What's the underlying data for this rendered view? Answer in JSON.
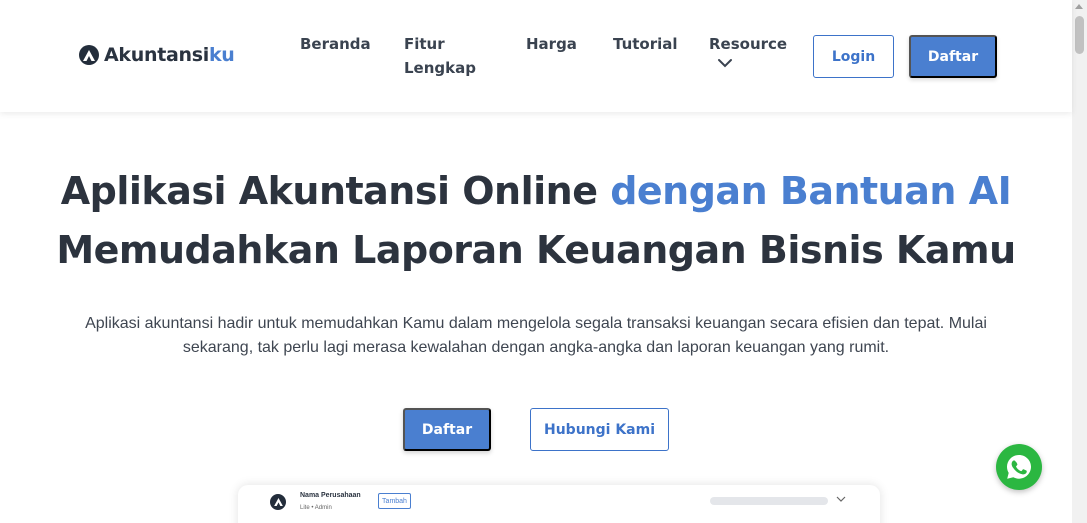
{
  "brand": {
    "name_main": "Akuntansi",
    "name_accent": "ku",
    "accent_color": "#4a7fd0"
  },
  "nav": {
    "beranda": "Beranda",
    "fitur": "Fitur Lengkap",
    "harga": "Harga",
    "tutorial": "Tutorial",
    "resource": "Resource",
    "login": "Login",
    "daftar": "Daftar"
  },
  "hero": {
    "title_part1": "Aplikasi Akuntansi Online ",
    "title_highlight": "dengan Bantuan AI",
    "title_line2": "Memudahkan Laporan Keuangan Bisnis Kamu",
    "description": "Aplikasi akuntansi hadir untuk memudahkan Kamu dalam mengelola segala transaksi keuangan secara efisien dan tepat. Mulai sekarang, tak perlu lagi merasa kewalahan dengan angka-angka dan laporan keuangan yang rumit.",
    "cta_primary": "Daftar",
    "cta_secondary": "Hubungi Kami"
  },
  "preview": {
    "company_name": "Nama Perusahaan",
    "role": "Lite  •  Admin",
    "add_button": "Tambah"
  },
  "icons": {
    "logo": "akuntansiku-logo-icon",
    "resource_dropdown": "chevron-down-icon",
    "whatsapp": "whatsapp-icon"
  }
}
